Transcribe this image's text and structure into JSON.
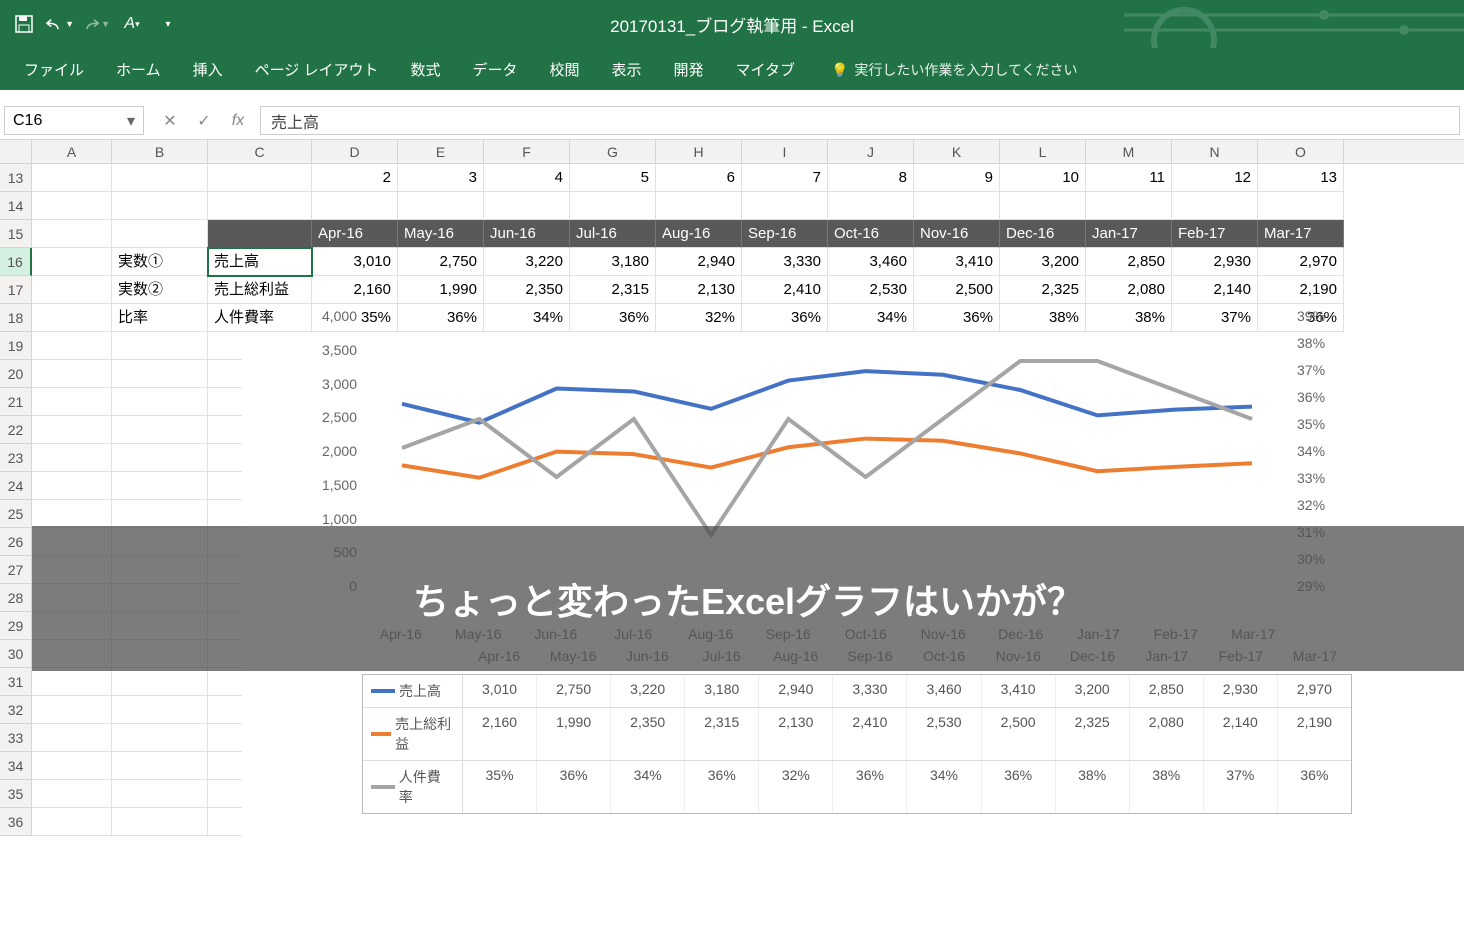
{
  "title": "20170131_ブログ執筆用  -  Excel",
  "qat": {
    "save": "save-icon",
    "undo": "undo-icon",
    "redo": "redo-icon",
    "touch": "touch-icon"
  },
  "ribbon": {
    "tabs": [
      "ファイル",
      "ホーム",
      "挿入",
      "ページ レイアウト",
      "数式",
      "データ",
      "校閲",
      "表示",
      "開発",
      "マイタブ"
    ],
    "tellme": "実行したい作業を入力してください"
  },
  "namebox": "C16",
  "formula": "売上高",
  "cols": [
    "A",
    "B",
    "C",
    "D",
    "E",
    "F",
    "G",
    "H",
    "I",
    "J",
    "K",
    "L",
    "M",
    "N",
    "O"
  ],
  "row_nums": [
    13,
    14,
    15,
    16,
    17,
    18,
    19,
    20,
    21,
    22,
    23,
    24,
    25,
    26,
    27,
    28,
    29,
    30,
    31,
    32,
    33,
    34,
    35,
    36
  ],
  "r13": [
    "",
    "",
    "",
    "2",
    "3",
    "4",
    "5",
    "6",
    "7",
    "8",
    "9",
    "10",
    "11",
    "12",
    "13"
  ],
  "months": [
    "Apr-16",
    "May-16",
    "Jun-16",
    "Jul-16",
    "Aug-16",
    "Sep-16",
    "Oct-16",
    "Nov-16",
    "Dec-16",
    "Jan-17",
    "Feb-17",
    "Mar-17"
  ],
  "labels": {
    "b16": "実数①",
    "c16": "売上高",
    "b17": "実数②",
    "c17": "売上総利益",
    "b18": "比率",
    "c18": "人件費率"
  },
  "sales": [
    "3,010",
    "2,750",
    "3,220",
    "3,180",
    "2,940",
    "3,330",
    "3,460",
    "3,410",
    "3,200",
    "2,850",
    "2,930",
    "2,970"
  ],
  "gross": [
    "2,160",
    "1,990",
    "2,350",
    "2,315",
    "2,130",
    "2,410",
    "2,530",
    "2,500",
    "2,325",
    "2,080",
    "2,140",
    "2,190"
  ],
  "ratio": [
    "35%",
    "36%",
    "34%",
    "36%",
    "32%",
    "36%",
    "34%",
    "36%",
    "38%",
    "38%",
    "37%",
    "36%"
  ],
  "banner": "ちょっと変わったExcelグラフはいかが？",
  "chart_data": {
    "type": "line",
    "categories": [
      "Apr-16",
      "May-16",
      "Jun-16",
      "Jul-16",
      "Aug-16",
      "Sep-16",
      "Oct-16",
      "Nov-16",
      "Dec-16",
      "Jan-17",
      "Feb-17",
      "Mar-17"
    ],
    "series": [
      {
        "name": "売上高",
        "axis": "left",
        "color": "#4472C4",
        "values": [
          3010,
          2750,
          3220,
          3180,
          2940,
          3330,
          3460,
          3410,
          3200,
          2850,
          2930,
          2970
        ]
      },
      {
        "name": "売上総利益",
        "axis": "left",
        "color": "#ED7D31",
        "values": [
          2160,
          1990,
          2350,
          2315,
          2130,
          2410,
          2530,
          2500,
          2325,
          2080,
          2140,
          2190
        ]
      },
      {
        "name": "人件費率",
        "axis": "right",
        "color": "#A5A5A5",
        "values": [
          35,
          36,
          34,
          36,
          32,
          36,
          34,
          36,
          38,
          38,
          37,
          36
        ]
      }
    ],
    "ylim_left": [
      0,
      4000
    ],
    "yticks_left": [
      0,
      500,
      1000,
      1500,
      2000,
      2500,
      3000,
      3500,
      4000
    ],
    "ylim_right": [
      29,
      39
    ],
    "yticks_right": [
      "29%",
      "30%",
      "31%",
      "32%",
      "33%",
      "34%",
      "35%",
      "36%",
      "37%",
      "38%",
      "39%"
    ],
    "ytick_labels_left": [
      "0",
      "500",
      "1,000",
      "1,500",
      "2,000",
      "2,500",
      "3,000",
      "3,500",
      "4,000"
    ]
  },
  "legend": {
    "s1": "売上高",
    "s2": "売上総利益",
    "s3": "人件費率"
  }
}
